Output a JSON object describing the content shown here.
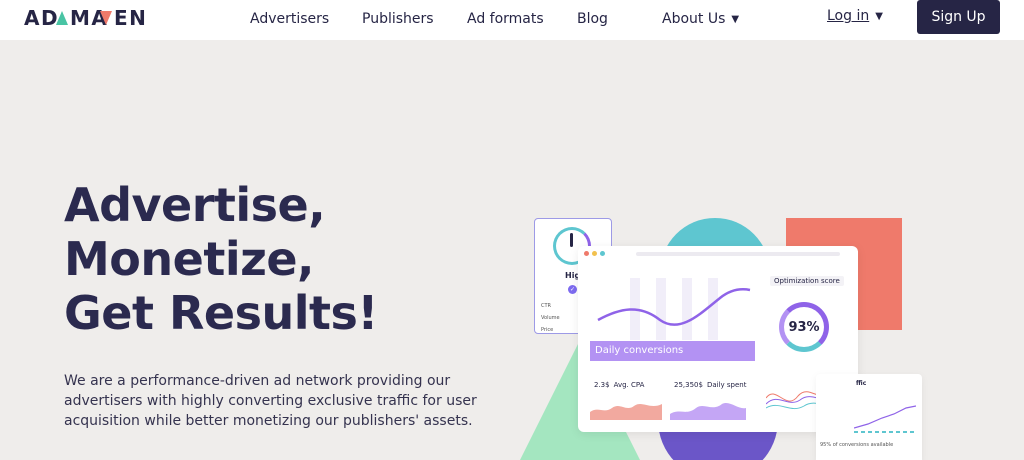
{
  "brand": {
    "logo": "ADMAVEN"
  },
  "nav": {
    "items": [
      {
        "label": "Advertisers"
      },
      {
        "label": "Publishers"
      },
      {
        "label": "Ad formats"
      },
      {
        "label": "Blog"
      },
      {
        "label": "About Us",
        "icon": "chevron-down-icon"
      }
    ],
    "login_label": "Log in",
    "signup_label": "Sign Up"
  },
  "hero": {
    "title_lines": [
      "Advertise,",
      "Monetize,",
      "Get Results!"
    ],
    "description": "We are a performance-driven ad network providing our advertisers with highly converting exclusive traffic for user acquisition while better monetizing our publishers' assets."
  },
  "illustration": {
    "left_card": {
      "label": "High",
      "rows": [
        "CTR",
        "Volume",
        "Price"
      ]
    },
    "main_card": {
      "chart_label": "Daily conversions",
      "optimization_label": "Optimization score",
      "score": "93%",
      "stats": [
        {
          "value": "2.3$",
          "label": "Avg. CPA"
        },
        {
          "value": "25,350$",
          "label": "Daily spent"
        }
      ]
    },
    "right_card": {
      "title": "ffic",
      "footer": "95% of conversions available"
    }
  },
  "colors": {
    "brand_dark": "#262545",
    "brand_teal": "#49c4a4",
    "coral": "#ef7a6b",
    "teal": "#5ec6d0",
    "mint": "#a4e6c0",
    "purple": "#6b56c8",
    "lavender": "#b392f3"
  }
}
